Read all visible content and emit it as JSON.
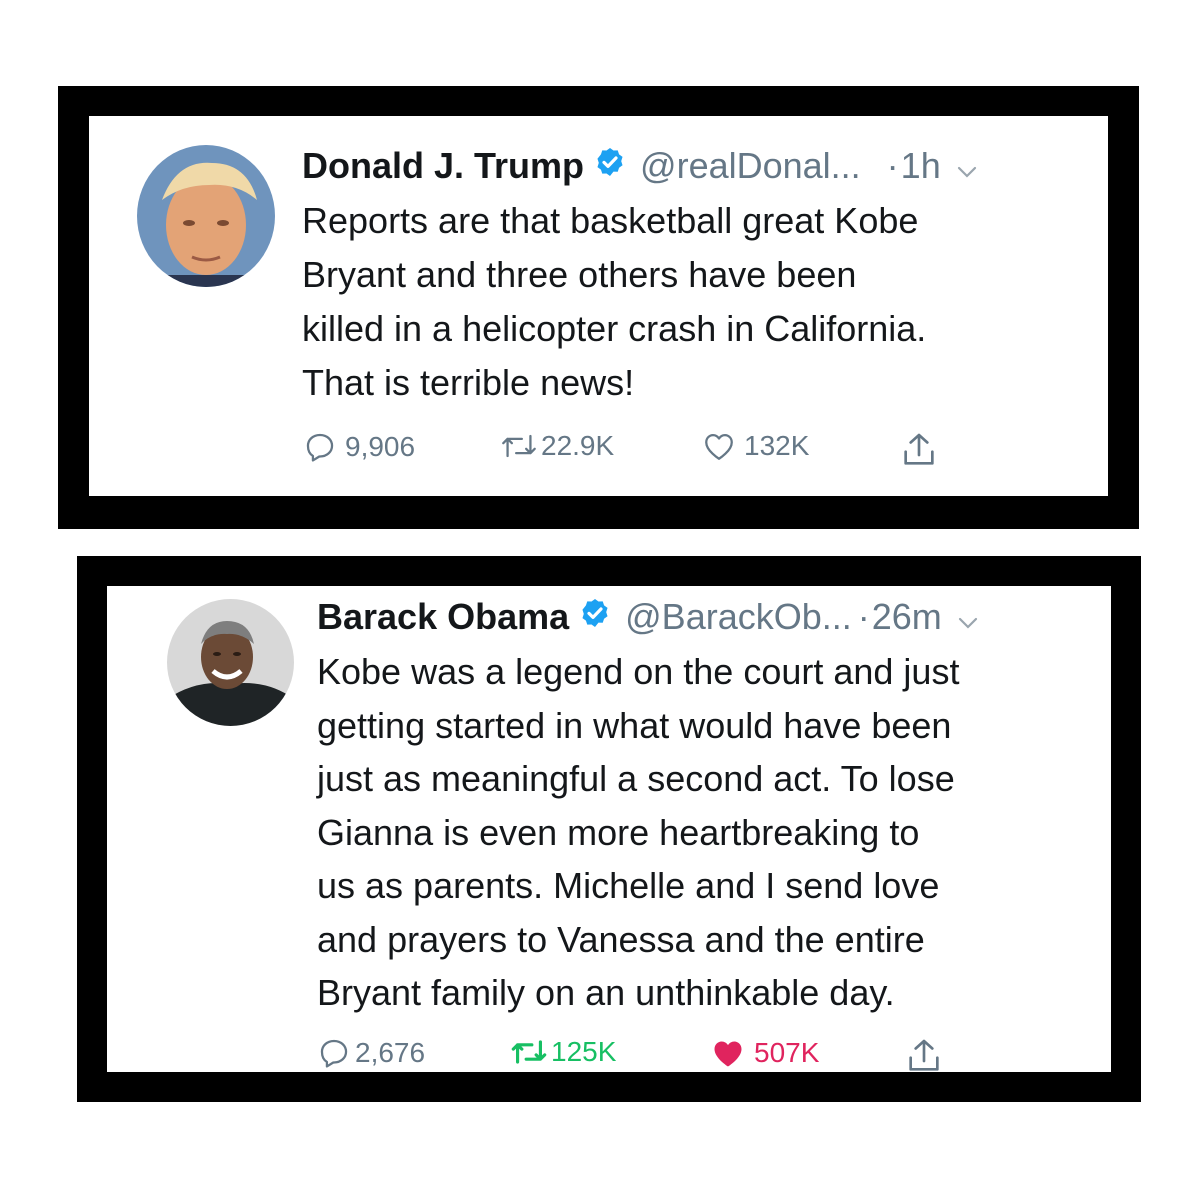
{
  "tweets": [
    {
      "author": {
        "name": "Donald J. Trump",
        "handle": "@realDonal...",
        "verified": true,
        "avatar": "portrait-avatar"
      },
      "separator": "·",
      "time": "1h",
      "text": [
        "Reports are that basketball great Kobe",
        "Bryant and three others have been",
        "killed in a helicopter crash in California.",
        "That is terrible news!"
      ],
      "actions": {
        "replies": "9,906",
        "retweets": "22.9K",
        "likes": "132K",
        "retweeted": false,
        "liked": false
      }
    },
    {
      "author": {
        "name": "Barack Obama",
        "handle": "@BarackOb...",
        "verified": true,
        "avatar": "portrait-avatar"
      },
      "separator": "·",
      "time": "26m",
      "text": [
        "Kobe was a legend on the court and just",
        "getting started in what would have been",
        "just as meaningful a second act. To lose",
        "Gianna is even more heartbreaking to",
        "us as parents. Michelle and I send love",
        "and prayers to Vanessa and the entire",
        "Bryant family on an unthinkable day."
      ],
      "actions": {
        "replies": "2,676",
        "retweets": "125K",
        "likes": "507K",
        "retweeted": true,
        "liked": true
      }
    }
  ],
  "colors": {
    "name": "#14171a",
    "secondary": "#657786",
    "verified": "#1da1f2",
    "retweet_active": "#17bf63",
    "like_active": "#e0245e"
  }
}
